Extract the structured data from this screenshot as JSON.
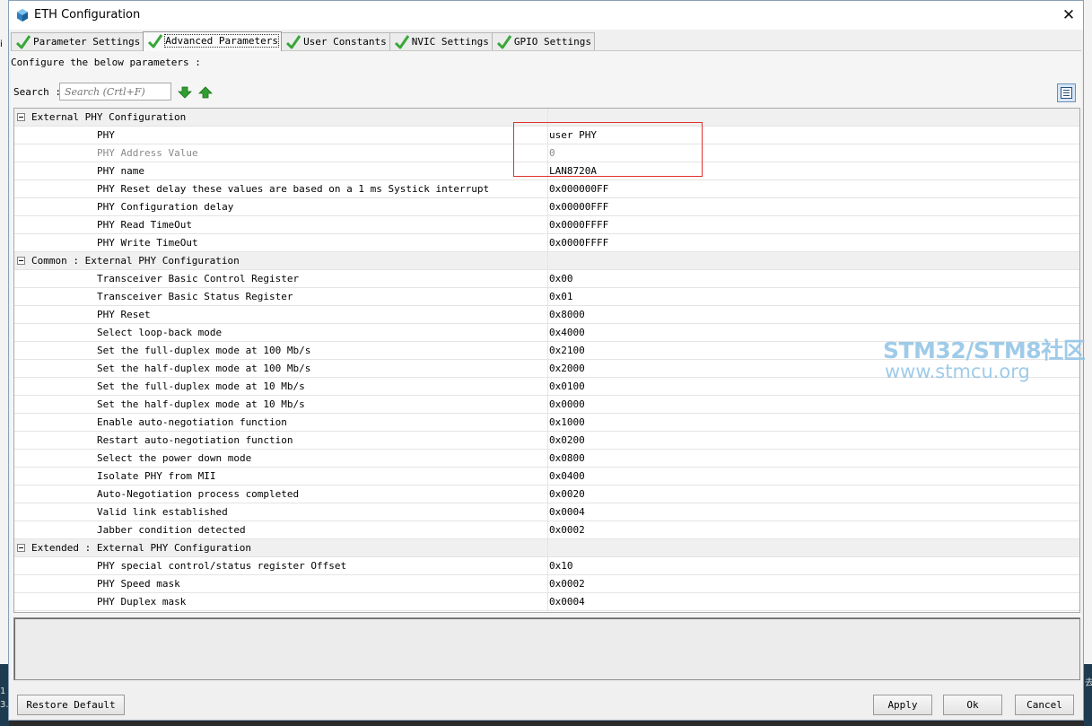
{
  "window": {
    "title": "ETH Configuration",
    "close_glyph": "✕"
  },
  "tabs": [
    {
      "label": "Parameter Settings",
      "icon": "green-check-icon",
      "active": false
    },
    {
      "label": "Advanced Parameters",
      "icon": "green-check-icon",
      "active": true
    },
    {
      "label": "User Constants",
      "icon": "green-check-icon",
      "active": false
    },
    {
      "label": "NVIC Settings",
      "icon": "green-check-icon",
      "active": false
    },
    {
      "label": "GPIO Settings",
      "icon": "green-check-icon",
      "active": false
    }
  ],
  "panel": {
    "configure_label": "Configure the below parameters :",
    "search_label": "Search :",
    "search_placeholder": "Search (Crtl+F)"
  },
  "table": {
    "groups": [
      {
        "name": "External PHY Configuration",
        "rows": [
          {
            "name": "PHY",
            "value": "user PHY"
          },
          {
            "name": "PHY Address Value",
            "value": "0",
            "disabled": true
          },
          {
            "name": "PHY name",
            "value": "LAN8720A"
          },
          {
            "name": "PHY Reset delay these values are based on a 1 ms Systick interrupt",
            "value": "0x000000FF"
          },
          {
            "name": "PHY Configuration delay",
            "value": "0x00000FFF"
          },
          {
            "name": "PHY Read TimeOut",
            "value": "0x0000FFFF"
          },
          {
            "name": "PHY Write TimeOut",
            "value": "0x0000FFFF"
          }
        ]
      },
      {
        "name": "Common : External PHY Configuration",
        "rows": [
          {
            "name": "Transceiver Basic Control Register",
            "value": "0x00"
          },
          {
            "name": "Transceiver Basic Status Register",
            "value": "0x01"
          },
          {
            "name": "PHY Reset",
            "value": "0x8000"
          },
          {
            "name": "Select loop-back mode",
            "value": "0x4000"
          },
          {
            "name": "Set the full-duplex mode at 100 Mb/s",
            "value": "0x2100"
          },
          {
            "name": "Set the half-duplex mode at 100 Mb/s",
            "value": "0x2000"
          },
          {
            "name": "Set the full-duplex mode at 10 Mb/s",
            "value": "0x0100"
          },
          {
            "name": "Set the half-duplex mode at 10 Mb/s",
            "value": "0x0000"
          },
          {
            "name": "Enable auto-negotiation function",
            "value": "0x1000"
          },
          {
            "name": "Restart auto-negotiation function",
            "value": "0x0200"
          },
          {
            "name": "Select the power down mode",
            "value": "0x0800"
          },
          {
            "name": "Isolate PHY from MII",
            "value": "0x0400"
          },
          {
            "name": "Auto-Negotiation process completed",
            "value": "0x0020"
          },
          {
            "name": "Valid link established",
            "value": "0x0004"
          },
          {
            "name": "Jabber condition detected",
            "value": "0x0002"
          }
        ]
      },
      {
        "name": "Extended : External PHY Configuration",
        "rows": [
          {
            "name": "PHY special control/status register Offset",
            "value": "0x10"
          },
          {
            "name": "PHY Speed mask",
            "value": "0x0002"
          },
          {
            "name": "PHY Duplex mask",
            "value": "0x0004"
          }
        ]
      }
    ]
  },
  "buttons": {
    "restore_default": "Restore Default",
    "apply": "Apply",
    "ok": "Ok",
    "cancel": "Cancel"
  },
  "watermark": {
    "line1": "STM32/STM8社区",
    "line2": "www.stmcu.org"
  },
  "background_fragments": {
    "left_top": "i",
    "left_bottom_1": "1",
    "left_bottom_2": "3.",
    "right_bottom": "去"
  },
  "colors": {
    "check_green": "#3aa63a",
    "arrow_green": "#2fa02f",
    "highlight_red": "#e03030",
    "watermark": "#8fc3e6"
  }
}
